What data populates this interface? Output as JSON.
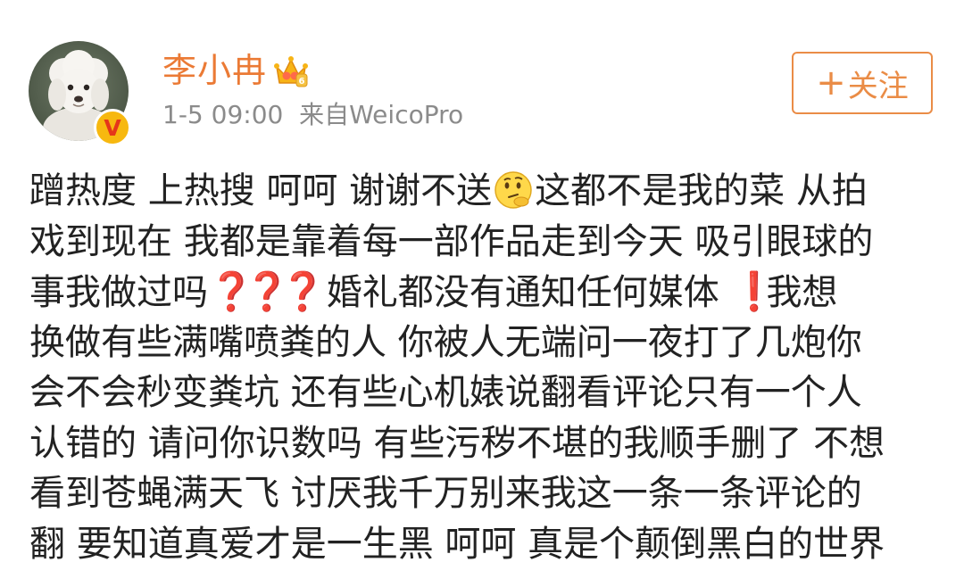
{
  "user": {
    "name": "李小冉",
    "vip_icon": "crown-badge-icon",
    "verified_icon": "verified-v-icon",
    "verified_mark": "V",
    "avatar_icon": "white-poodle-avatar"
  },
  "meta": {
    "time": "1-5 09:00",
    "source": "来自WeicoPro"
  },
  "follow_button": {
    "icon": "+",
    "label": "关注"
  },
  "post": {
    "line1a": "蹭热度 上热搜 呵呵 谢谢不送",
    "line1b": "这都不是我的菜 从拍",
    "line2": "戏到现在 我都是靠着每一部作品走到今天 吸引眼球的",
    "line3a": "事我做过吗",
    "line3b": "婚礼都没有通知任何媒体",
    "line3c": "我想",
    "line4": "换做有些满嘴喷粪的人 你被人无端问一夜打了几炮你",
    "line5": "会不会秒变粪坑 还有些心机婊说翻看评论只有一个人",
    "line6": "认错的 请问你识数吗 有些污秽不堪的我顺手删了 不想",
    "line7": "看到苍蝇满天飞 讨厌我千万别来我这一条一条评论的",
    "line8": "翻 要知道真爱才是一生黑 呵呵 真是个颠倒黑白的世界",
    "question_mark": "❓",
    "exclamation_mark": "❗",
    "thinking_emoji": "thinking-face-emoji"
  },
  "colors": {
    "username": "#eb7a35",
    "follow_border": "#ea8c46",
    "meta_text": "#8b8b8b",
    "body_text": "#222222",
    "mark_red": "#e0282c"
  }
}
